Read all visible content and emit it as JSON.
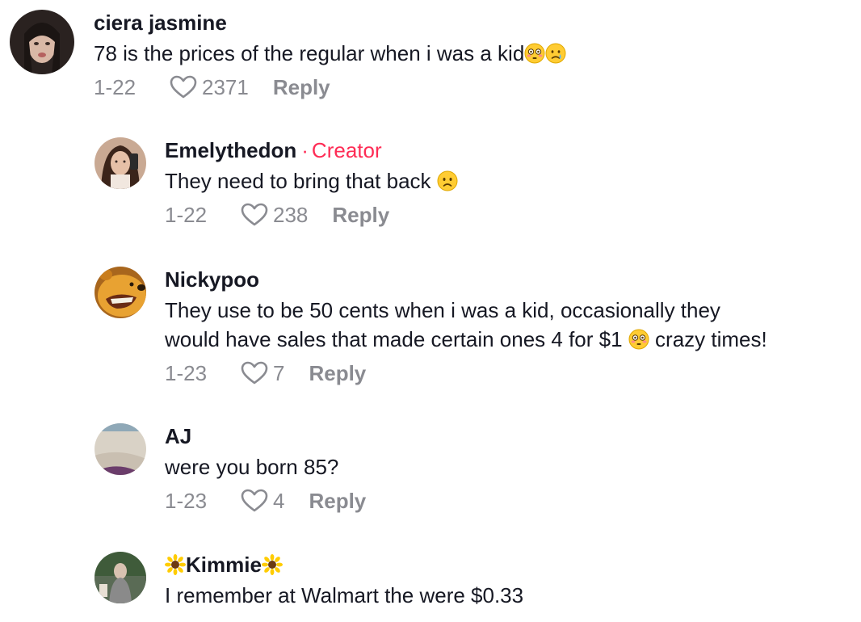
{
  "comments": [
    {
      "username": "ciera jasmine",
      "text": "78 is the prices of the regular when i was a kid",
      "emojis": [
        "flushed-face",
        "crying-face"
      ],
      "date": "1-22",
      "likes": "2371",
      "reply_label": "Reply"
    },
    {
      "username": "Emelythedon",
      "badge_separator": "·",
      "badge": "Creator",
      "text": "They need to bring that back",
      "emojis": [
        "frowning-face"
      ],
      "date": "1-22",
      "likes": "238",
      "reply_label": "Reply"
    },
    {
      "username": "Nickypoo",
      "text_line1": "They use to be 50 cents when i was a kid, occasionally they",
      "text_line2a": "would have sales that made certain ones 4 for $1",
      "text_line2b": "crazy times!",
      "emojis": [
        "flushed-face"
      ],
      "date": "1-23",
      "likes": "7",
      "reply_label": "Reply"
    },
    {
      "username": "AJ",
      "text": "were you born 85?",
      "date": "1-23",
      "likes": "4",
      "reply_label": "Reply"
    },
    {
      "username": "Kimmie",
      "username_emojis": [
        "sunflower",
        "sunflower"
      ],
      "text": "I remember at Walmart the were $0.33"
    }
  ],
  "colors": {
    "text": "#161823",
    "meta": "#8a8b91",
    "creator": "#fe2c55"
  }
}
